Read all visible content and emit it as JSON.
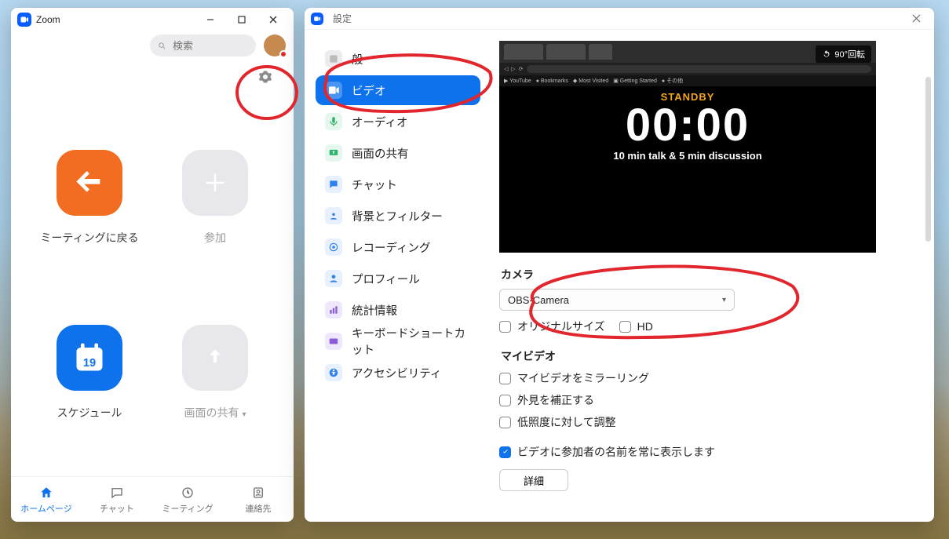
{
  "main": {
    "title": "Zoom",
    "search_placeholder": "検索",
    "tiles": {
      "return": "ミーティングに戻る",
      "join": "参加",
      "schedule": "スケジュール",
      "schedule_day": "19",
      "share": "画面の共有"
    },
    "nav": {
      "home": "ホームページ",
      "chat": "チャット",
      "meetings": "ミーティング",
      "contacts": "連絡先"
    }
  },
  "settings": {
    "title": "設定",
    "nav": {
      "general": "般",
      "video": "ビデオ",
      "audio": "オーディオ",
      "share": "画面の共有",
      "chat": "チャット",
      "background": "背景とフィルター",
      "recording": "レコーディング",
      "profile": "プロフィール",
      "stats": "統計情報",
      "keyboard": "キーボードショートカット",
      "accessibility": "アクセシビリティ"
    },
    "preview": {
      "standby": "STANDBY",
      "timer": "00:00",
      "subtitle": "10 min talk & 5 min discussion",
      "rotate": "90°回転"
    },
    "camera": {
      "heading": "カメラ",
      "selected": "OBS-Camera",
      "orig": "オリジナルサイズ",
      "hd": "HD"
    },
    "myvideo": {
      "heading": "マイビデオ",
      "mirror": "マイビデオをミラーリング",
      "touchup": "外見を補正する",
      "lowlight": "低照度に対して調整"
    },
    "always_show_names": "ビデオに参加者の名前を常に表示します",
    "details_btn": "詳細"
  }
}
